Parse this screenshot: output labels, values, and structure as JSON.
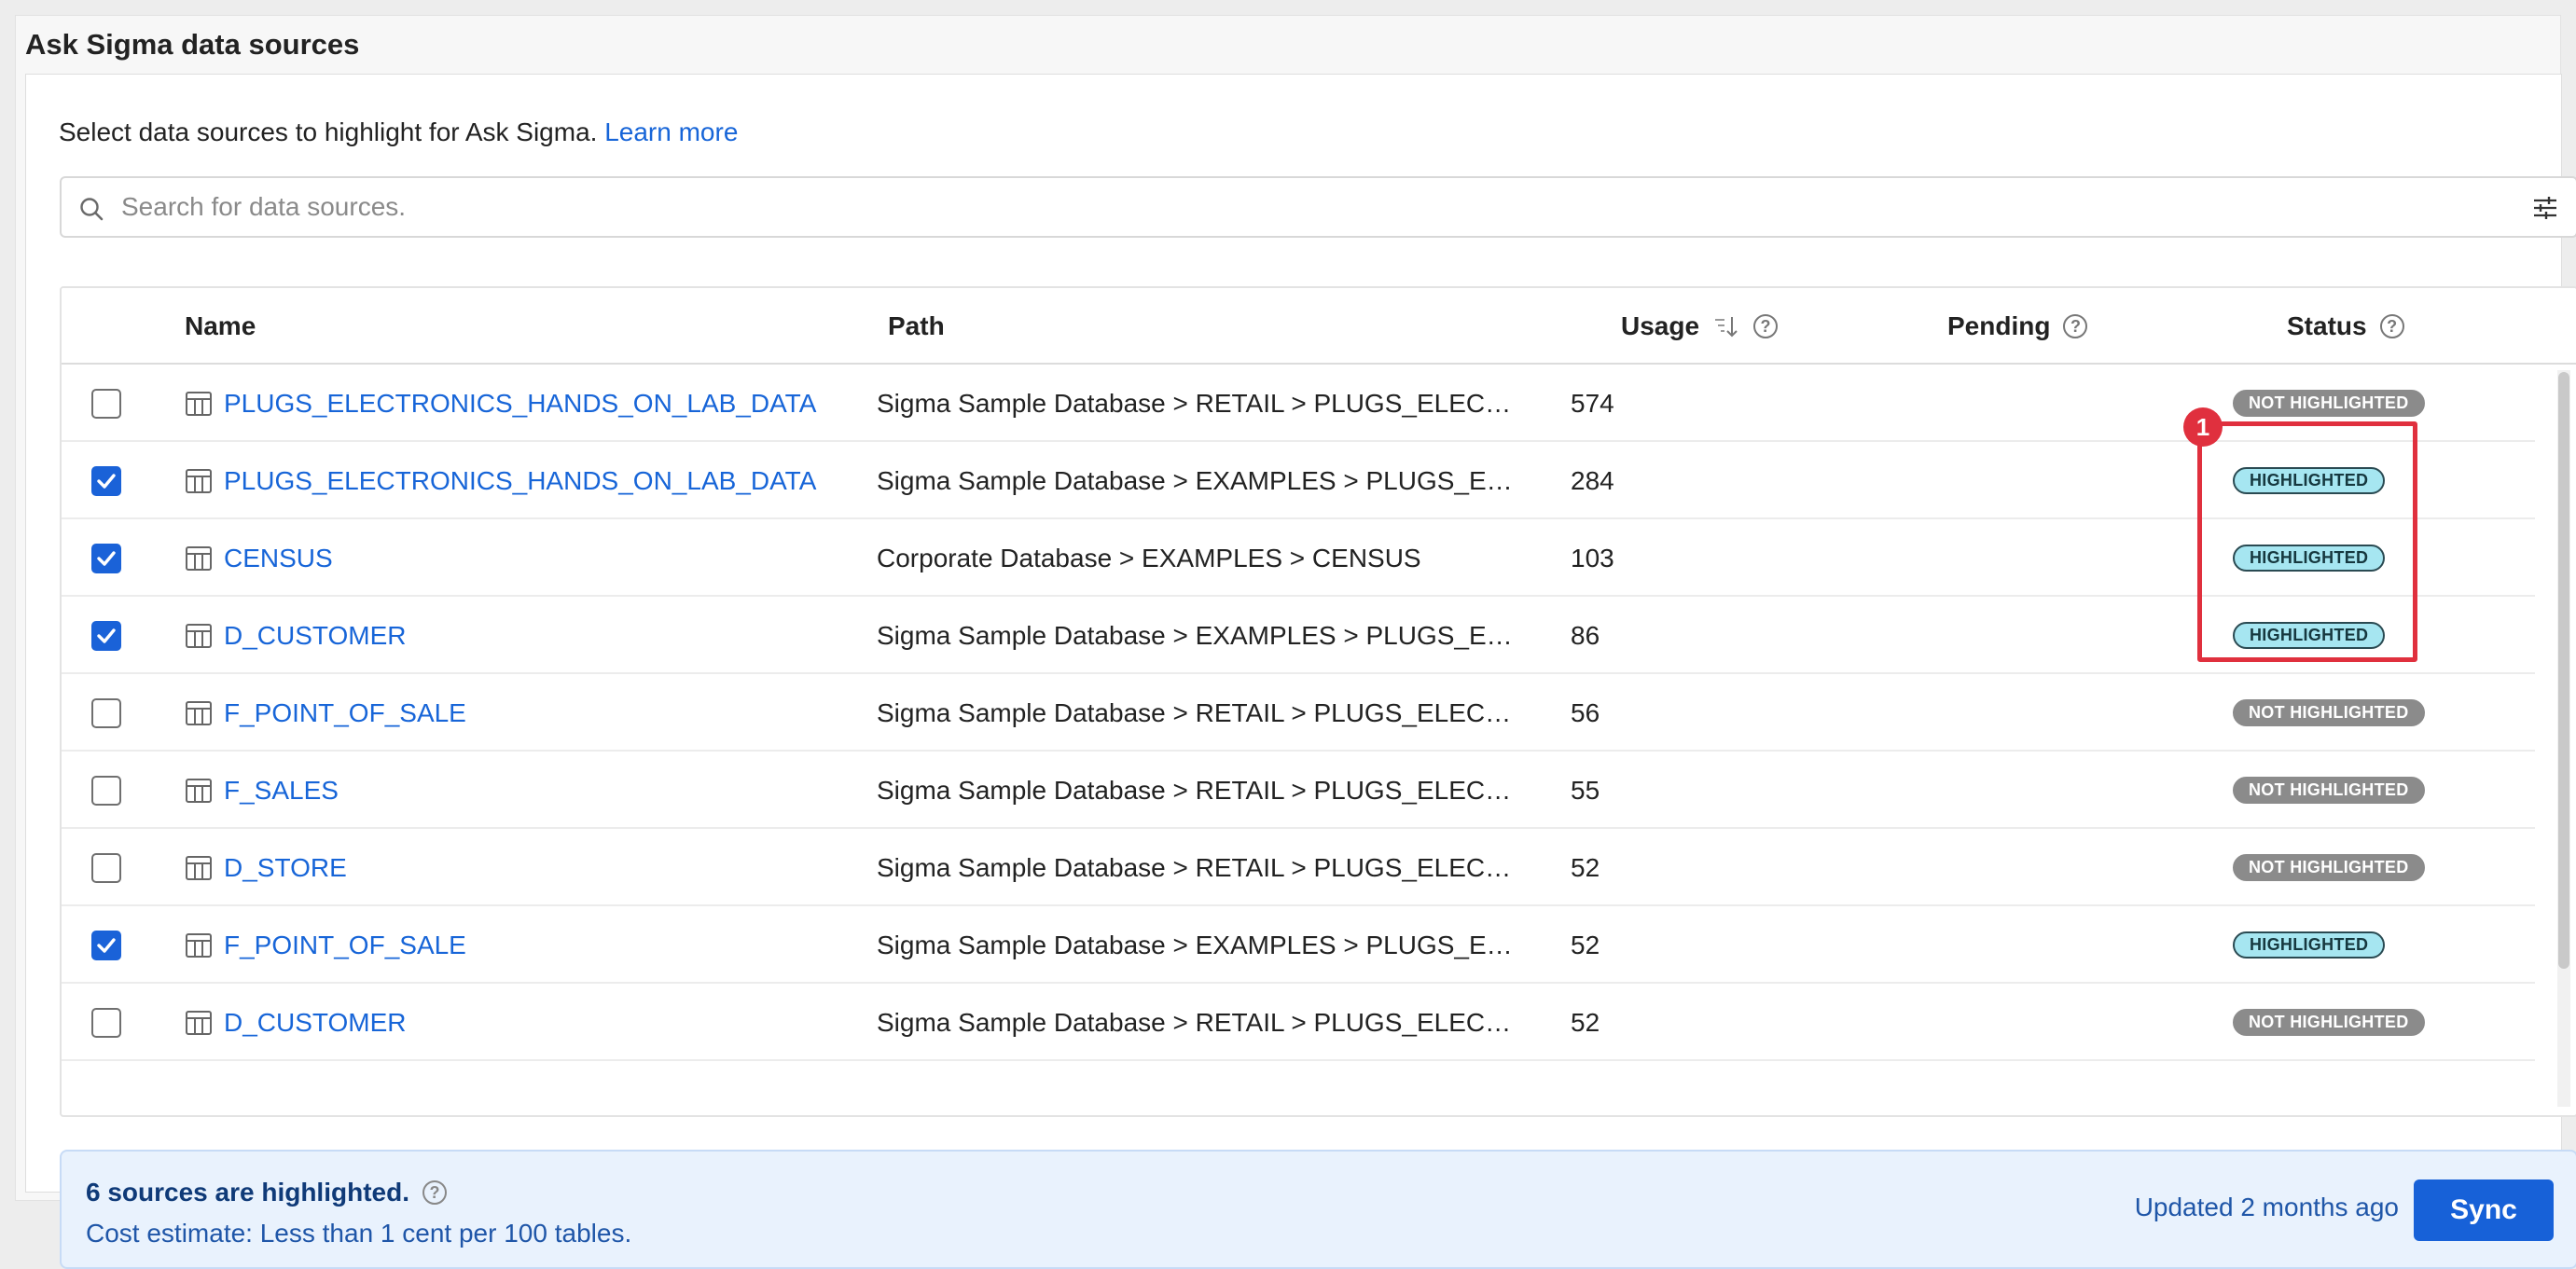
{
  "panel": {
    "title": "Ask Sigma data sources"
  },
  "intro": {
    "text": "Select data sources to highlight for Ask Sigma. ",
    "link": "Learn more"
  },
  "search": {
    "placeholder": "Search for data sources."
  },
  "table": {
    "columns": {
      "name": "Name",
      "path": "Path",
      "usage": "Usage",
      "pending": "Pending",
      "status": "Status"
    },
    "rows": [
      {
        "checked": false,
        "name": "PLUGS_ELECTRONICS_HANDS_ON_LAB_DATA",
        "path": "Sigma Sample Database > RETAIL > PLUGS_ELECTRO…",
        "usage": "574",
        "status": "NOT HIGHLIGHTED"
      },
      {
        "checked": true,
        "name": "PLUGS_ELECTRONICS_HANDS_ON_LAB_DATA",
        "path": "Sigma Sample Database > EXAMPLES > PLUGS_ELECT…",
        "usage": "284",
        "status": "HIGHLIGHTED"
      },
      {
        "checked": true,
        "name": "CENSUS",
        "path": "Corporate Database > EXAMPLES > CENSUS",
        "usage": "103",
        "status": "HIGHLIGHTED"
      },
      {
        "checked": true,
        "name": "D_CUSTOMER",
        "path": "Sigma Sample Database > EXAMPLES > PLUGS_ELECT…",
        "usage": "86",
        "status": "HIGHLIGHTED"
      },
      {
        "checked": false,
        "name": "F_POINT_OF_SALE",
        "path": "Sigma Sample Database > RETAIL > PLUGS_ELECTRO…",
        "usage": "56",
        "status": "NOT HIGHLIGHTED"
      },
      {
        "checked": false,
        "name": "F_SALES",
        "path": "Sigma Sample Database > RETAIL > PLUGS_ELECTRO…",
        "usage": "55",
        "status": "NOT HIGHLIGHTED"
      },
      {
        "checked": false,
        "name": "D_STORE",
        "path": "Sigma Sample Database > RETAIL > PLUGS_ELECTRO…",
        "usage": "52",
        "status": "NOT HIGHLIGHTED"
      },
      {
        "checked": true,
        "name": "F_POINT_OF_SALE",
        "path": "Sigma Sample Database > EXAMPLES > PLUGS_ELECT…",
        "usage": "52",
        "status": "HIGHLIGHTED"
      },
      {
        "checked": false,
        "name": "D_CUSTOMER",
        "path": "Sigma Sample Database > RETAIL > PLUGS_ELECTRO…",
        "usage": "52",
        "status": "NOT HIGHLIGHTED"
      }
    ]
  },
  "annotation": {
    "number": "1"
  },
  "footer": {
    "summary": "6 sources are highlighted.",
    "cost": "Cost estimate: Less than 1 cent per 100 tables.",
    "updated": "Updated 2 months ago",
    "sync_label": "Sync"
  },
  "colors": {
    "link": "#1765d8",
    "checkbox_checked": "#1a62d8",
    "badge_highlighted": "#a6e6f1",
    "badge_not_highlighted": "#8b8b8b",
    "annotation": "#e0303e",
    "sync_button": "#1761d8"
  },
  "icons": {
    "search": "search-icon",
    "filter": "filter-settings-icon",
    "table": "table-icon",
    "sort": "sort-descending-icon",
    "help": "help-icon"
  }
}
